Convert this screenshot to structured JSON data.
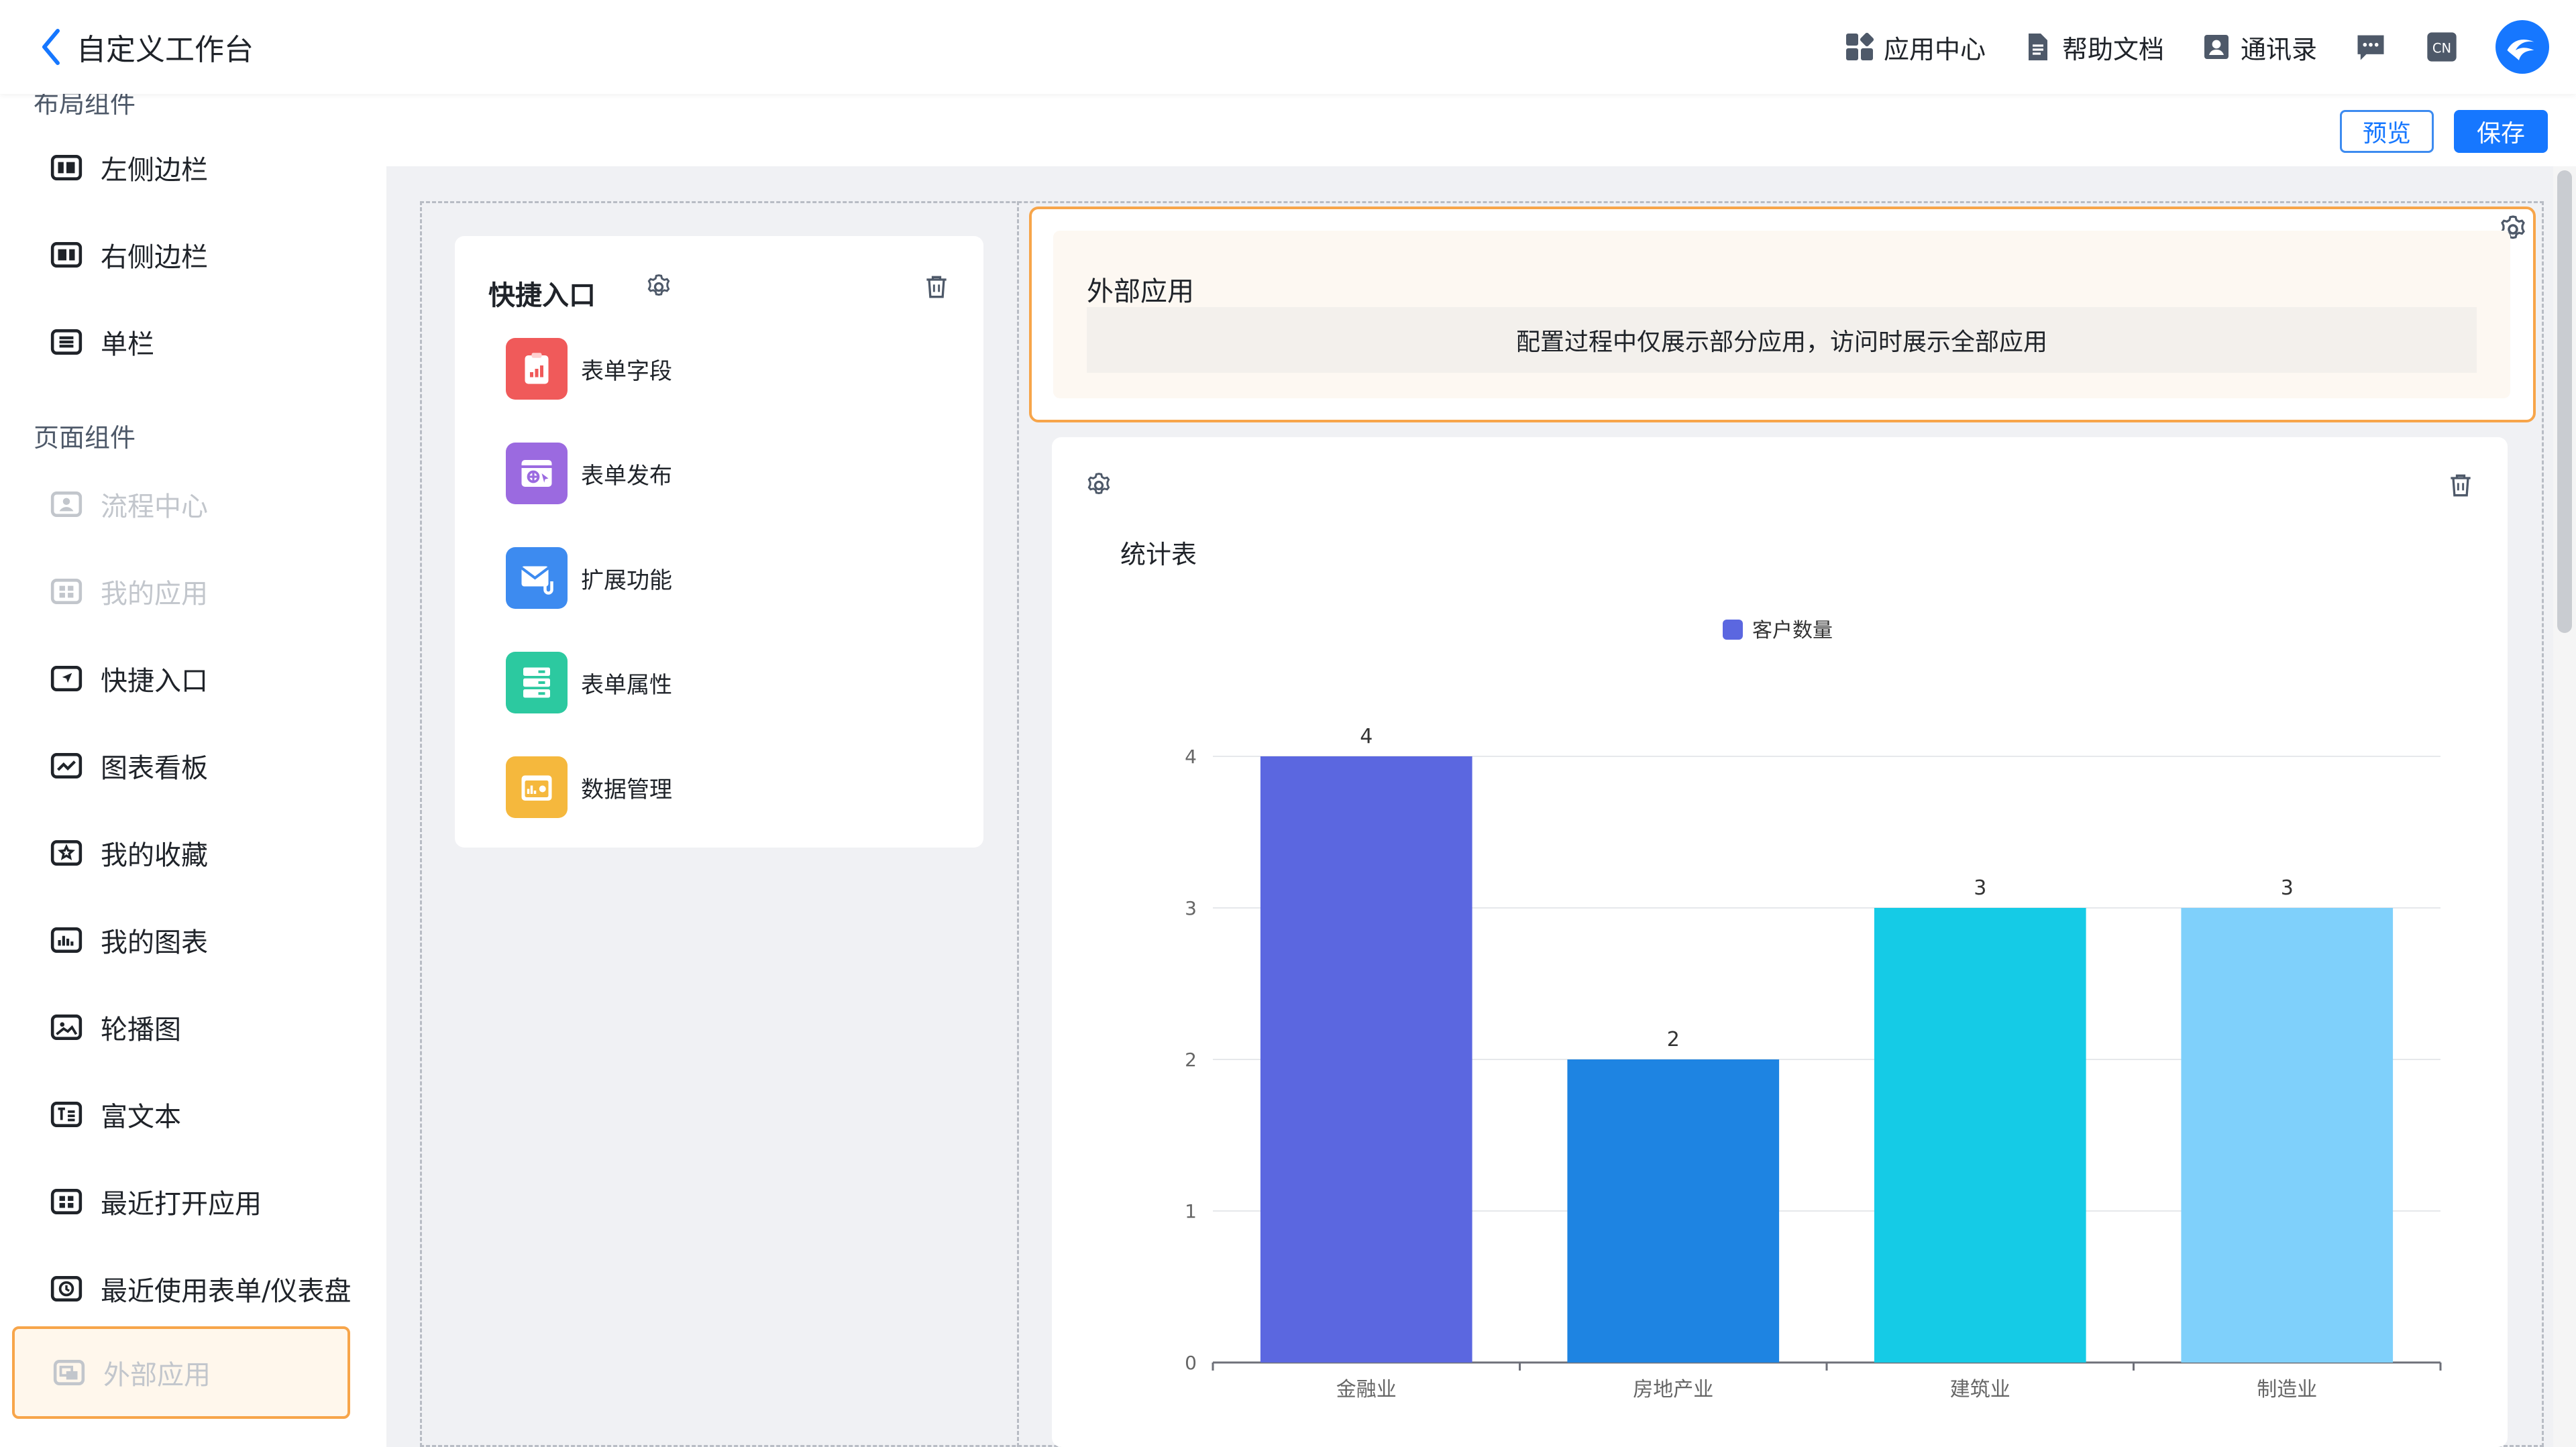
{
  "header": {
    "back_label": "自定义工作台",
    "nav": [
      {
        "label": "应用中心",
        "icon": "app-grid-icon"
      },
      {
        "label": "帮助文档",
        "icon": "document-icon"
      },
      {
        "label": "通讯录",
        "icon": "contacts-icon"
      }
    ],
    "icons": [
      "message-icon",
      "language-cn-icon",
      "user-avatar-icon"
    ],
    "language_label": "CN"
  },
  "sidebar": {
    "section_layout": "布局组件",
    "layout_items": [
      {
        "label": "左侧边栏",
        "icon": "left-sidebar-icon"
      },
      {
        "label": "右侧边栏",
        "icon": "right-sidebar-icon"
      },
      {
        "label": "单栏",
        "icon": "single-column-icon"
      }
    ],
    "section_page": "页面组件",
    "page_items": [
      {
        "label": "流程中心",
        "icon": "process-icon",
        "disabled": true
      },
      {
        "label": "我的应用",
        "icon": "my-apps-icon",
        "disabled": true
      },
      {
        "label": "快捷入口",
        "icon": "shortcut-icon",
        "disabled": false
      },
      {
        "label": "图表看板",
        "icon": "chart-board-icon",
        "disabled": false
      },
      {
        "label": "我的收藏",
        "icon": "favorites-icon",
        "disabled": false
      },
      {
        "label": "我的图表",
        "icon": "my-chart-icon",
        "disabled": false
      },
      {
        "label": "轮播图",
        "icon": "carousel-icon",
        "disabled": false
      },
      {
        "label": "富文本",
        "icon": "rich-text-icon",
        "disabled": false
      },
      {
        "label": "最近打开应用",
        "icon": "recent-apps-icon",
        "disabled": false
      },
      {
        "label": "最近使用表单/仪表盘",
        "icon": "clock-icon",
        "disabled": false
      },
      {
        "label": "外部应用",
        "icon": "external-app-icon",
        "disabled": true,
        "active": true
      }
    ]
  },
  "toolbar": {
    "preview_label": "预览",
    "save_label": "保存"
  },
  "quick_entry": {
    "title": "快捷入口",
    "items": [
      {
        "label": "表单字段",
        "icon": "clipboard-chart-icon",
        "color": "#f05a5a"
      },
      {
        "label": "表单发布",
        "icon": "browser-publish-icon",
        "color": "#9b6ae0"
      },
      {
        "label": "扩展功能",
        "icon": "mail-attach-icon",
        "color": "#3d8bf0"
      },
      {
        "label": "表单属性",
        "icon": "server-list-icon",
        "color": "#2cc9a0"
      },
      {
        "label": "数据管理",
        "icon": "data-folder-icon",
        "color": "#f5b83d"
      }
    ]
  },
  "external_app": {
    "title": "外部应用",
    "note": "配置过程中仅展示部分应用，访问时展示全部应用"
  },
  "chart_card": {
    "title": "统计表"
  },
  "chart_data": {
    "type": "bar",
    "categories": [
      "金融业",
      "房地产业",
      "建筑业",
      "制造业"
    ],
    "series": [
      {
        "name": "客户数量",
        "values": [
          4,
          2,
          3,
          3
        ]
      }
    ],
    "colors": [
      "#5b67e0",
      "#1e84e2",
      "#15cbe6",
      "#7fd0fb"
    ],
    "legend_color": "#5b67e0",
    "ylim": [
      0,
      4
    ],
    "yticks": [
      0,
      1,
      2,
      3,
      4
    ],
    "grid": true,
    "legend": "top-center",
    "data_labels": true
  }
}
